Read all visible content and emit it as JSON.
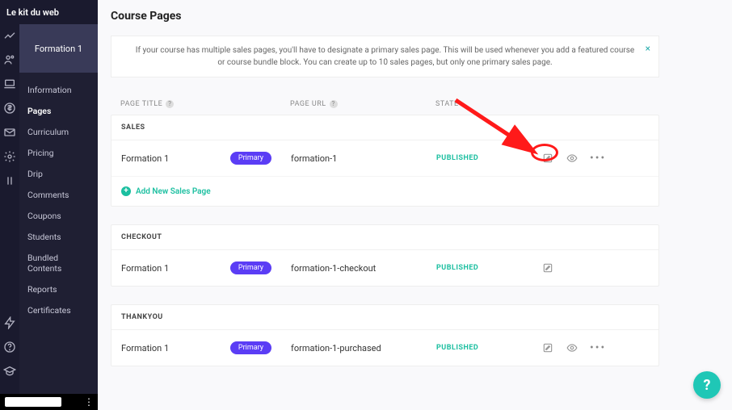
{
  "brand": "Le kit du web",
  "course_name": "Formation 1",
  "nav_items": [
    "Information",
    "Pages",
    "Curriculum",
    "Pricing",
    "Drip",
    "Comments",
    "Coupons",
    "Students",
    "Bundled Contents",
    "Reports",
    "Certificates"
  ],
  "nav_active_index": 1,
  "page_title": "Course Pages",
  "banner_text": "If your course has multiple sales pages, you'll have to designate a primary sales page. This will be used whenever you add a featured course or course bundle block. You can create up to 10 sales pages, but only one primary sales page.",
  "columns": {
    "title": "PAGE TITLE",
    "url": "PAGE URL",
    "state": "STATE"
  },
  "primary_badge": "Primary",
  "state_published": "PUBLISHED",
  "add_sales_label": "Add New Sales Page",
  "sections": [
    {
      "key": "sales",
      "header": "SALES",
      "rows": [
        {
          "title": "Formation 1",
          "url": "formation-1",
          "primary": true,
          "state": "PUBLISHED",
          "show_edit": true,
          "show_preview": true,
          "show_more": true
        }
      ],
      "add_row": true
    },
    {
      "key": "checkout",
      "header": "CHECKOUT",
      "rows": [
        {
          "title": "Formation 1",
          "url": "formation-1-checkout",
          "primary": true,
          "state": "PUBLISHED",
          "show_edit": true,
          "show_preview": false,
          "show_more": false
        }
      ],
      "add_row": false
    },
    {
      "key": "thankyou",
      "header": "THANKYOU",
      "rows": [
        {
          "title": "Formation 1",
          "url": "formation-1-purchased",
          "primary": true,
          "state": "PUBLISHED",
          "show_edit": true,
          "show_preview": true,
          "show_more": true
        }
      ],
      "add_row": false
    }
  ],
  "colors": {
    "accent": "#5b3df5",
    "published": "#1bbfa0",
    "annotation": "#ff1a1a",
    "fab": "#1fc7b6"
  }
}
